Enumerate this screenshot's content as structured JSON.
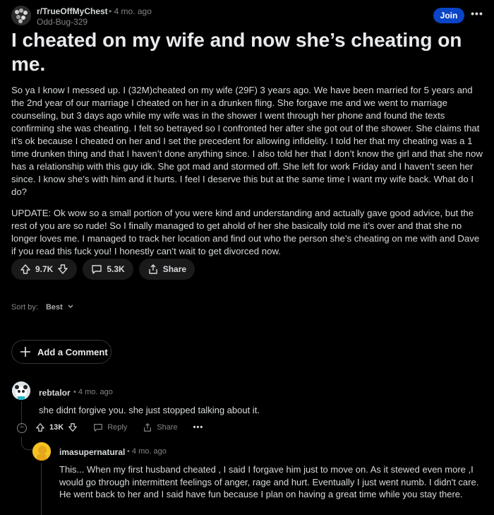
{
  "post": {
    "subreddit": "r/TrueOffMyChest",
    "age": "• 4 mo. ago",
    "author": "Odd-Bug-329",
    "join_label": "Join",
    "more_label": "•••",
    "title": "I cheated on my wife and now she’s cheating on me.",
    "body_p1": "So ya I know I messed up. I (32M)cheated on my wife (29F) 3 years ago. We have been married for 5 years and the 2nd year of our marriage I cheated on her in a drunken fling. She forgave me and we went to marriage counseling, but 3 days ago while my wife was in the shower I went through her phone and found the texts confirming she was cheating. I felt so betrayed so I confronted her after she got out of the shower. She claims that it’s ok because I cheated on her and I set the precedent for allowing infidelity. I told her that my cheating was a 1 time drunken thing and that I haven’t done anything since. I also told her that I don’t know the girl and that she now has a relationship with this guy idk. She got mad and stormed off. She left for work Friday and I haven’t seen her since. I know she’s with him and it hurts. I feel I deserve this but at the same time I want my wife back. What do I do?",
    "body_p2": "UPDATE: Ok wow so a small portion of you were kind and understanding and actually gave good advice, but the rest of you are so rude! So I finally managed to get ahold of her she basically told me it’s over and that she no longer loves me. I managed to track her location and find out who the person she’s cheating on me with and Dave if you read this fuck you! I honestly can’t wait to get divorced now.",
    "votes": "9.7K",
    "comments": "5.3K",
    "share_label": "Share"
  },
  "sort": {
    "label": "Sort by:",
    "value": "Best"
  },
  "add_comment_label": "Add a Comment",
  "comments": [
    {
      "user": "rebtalor",
      "age": "• 4 mo. ago",
      "text": "she didnt forgive you. she just stopped talking about it.",
      "score": "13K",
      "reply_label": "Reply",
      "share_label": "Share",
      "more_label": "•••",
      "collapse_label": "−"
    },
    {
      "user": "imasupernatural",
      "age": "• 4 mo. ago",
      "text": "This... When my first husband cheated , I said I forgave him just to move on. As it stewed even more ,I would go through intermittent feelings of anger, rage and hurt. Eventually I just went numb. I didn't care. He went back to her and I said have fun because I plan on having a great time while you stay there."
    }
  ],
  "colors": {
    "background": "#000000",
    "join": "#0a45c7",
    "pill": "#1a1a1b",
    "avatar2": "#f3c322"
  }
}
